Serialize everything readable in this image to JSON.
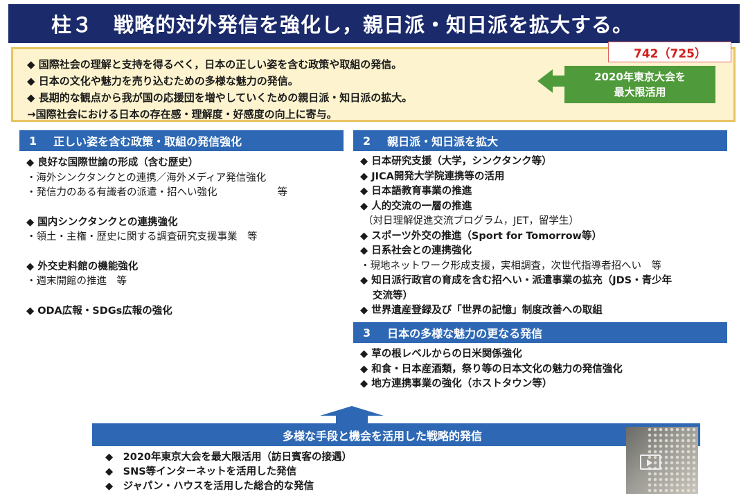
{
  "title": "柱３　戦略的対外発信を強化し，親日派・知日派を拡大する。",
  "summary": {
    "lines": [
      "◆ 国際社会の理解と支持を得るべく，日本の正しい姿を含む政策や取組の発信。",
      "◆ 日本の文化や魅力を売り込むための多様な魅力の発信。",
      "◆ 長期的な観点から我が国の応援団を増やしていくための親日派・知日派の拡大。",
      "→国際社会における日本の存在感・理解度・好感度の向上に寄与。"
    ]
  },
  "budget_label": "742（725）",
  "olympic_box": {
    "line1": "2020年東京大会を",
    "line2": "最大限活用"
  },
  "section1": {
    "num": "1",
    "title": "正しい姿を含む政策・取組の発信強化",
    "items": [
      "◆ 良好な国際世論の形成（含む歴史）",
      "・海外シンクタンクとの連携／海外メディア発信強化",
      "・発信力のある有識者の派遣・招へい強化　　　　　　等",
      "◆ 国内シンクタンクとの連携強化",
      "・領土・主権・歴史に関する調査研究支援事業　等",
      "◆ 外交史料館の機能強化",
      "・週末開館の推進　等",
      "◆ ODA広報・SDGs広報の強化"
    ]
  },
  "section2": {
    "num": "2",
    "title": "親日派・知日派を拡大",
    "items": [
      "◆ 日本研究支援（大学，シンクタンク等）",
      "◆ JICA開発大学院連携等の活用",
      "◆ 日本語教育事業の推進",
      "◆ 人的交流の一層の推進",
      "（対日理解促進交流プログラム，JET，留学生）",
      "◆ スポーツ外交の推進（Sport for Tomorrow等）",
      "◆ 日系社会との連携強化",
      "・現地ネットワーク形成支援，実相調査，次世代指導者招へい　等",
      "◆ 知日派行政官の育成を含む招へい・派遣事業の拡充（JDS・青少年",
      "交流等）",
      "◆ 世界遺産登録及び「世界の記憶」制度改善への取組"
    ]
  },
  "section3": {
    "num": "3",
    "title": "日本の多様な魅力の更なる発信",
    "items": [
      "◆ 草の根レベルからの日米関係強化",
      "◆ 和食・日本産酒類，祭り等の日本文化の魅力の発信強化",
      "◆ 地方連携事業の強化（ホストタウン等）"
    ]
  },
  "bottom": {
    "title": "多様な手段と機会を活用した戦略的発信",
    "items": [
      "◆　2020年東京大会を最大限活用（訪日賓客の接遇）",
      "◆　SNS等インターネットを活用した発信",
      "◆　ジャパン・ハウスを活用した総合的な発信"
    ]
  }
}
